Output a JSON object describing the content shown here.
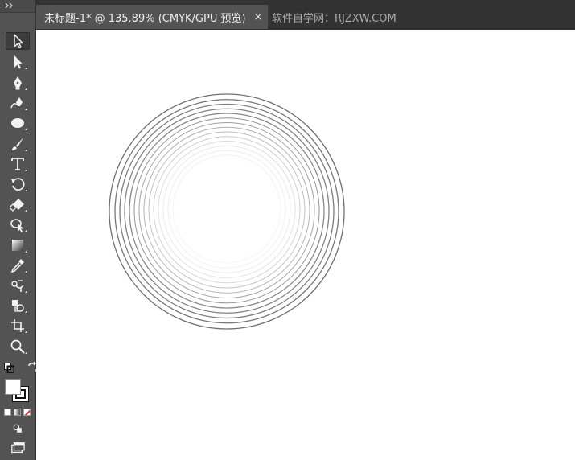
{
  "document": {
    "active_tab_title": "未标题-1* @ 135.89% (CMYK/GPU 预览)",
    "close_glyph": "×",
    "inactive_tab_title": "软件自学网：RJZXW.COM"
  },
  "toolbar": {
    "tools": [
      {
        "name": "selection-tool",
        "icon": "selection-arrow-icon",
        "active": true
      },
      {
        "name": "direct-selection-tool",
        "icon": "direct-selection-arrow-icon"
      },
      {
        "name": "pen-tool",
        "icon": "pen-icon"
      },
      {
        "name": "curvature-tool",
        "icon": "curvature-pen-icon"
      },
      {
        "name": "ellipse-tool",
        "icon": "ellipse-icon"
      },
      {
        "name": "paintbrush-tool",
        "icon": "paintbrush-icon"
      },
      {
        "name": "type-tool",
        "icon": "type-icon"
      },
      {
        "name": "rotate-tool",
        "icon": "rotate-icon"
      },
      {
        "name": "eraser-tool",
        "icon": "eraser-icon"
      },
      {
        "name": "shape-builder-tool",
        "icon": "shape-builder-icon"
      },
      {
        "name": "gradient-tool",
        "icon": "gradient-icon"
      },
      {
        "name": "eyedropper-tool",
        "icon": "eyedropper-icon"
      },
      {
        "name": "blend-tool",
        "icon": "blend-icon"
      },
      {
        "name": "symbol-sprayer-tool",
        "icon": "symbol-sprayer-icon"
      },
      {
        "name": "artboard-tool",
        "icon": "artboard-icon"
      },
      {
        "name": "zoom-tool",
        "icon": "zoom-icon"
      }
    ],
    "fill_color": "#ffffff",
    "stroke_color": "#000000"
  },
  "colors": {
    "ui_dark": "#323232",
    "toolbar": "#535353",
    "canvas": "#ffffff",
    "circle_stroke": "#6e6e6e"
  }
}
